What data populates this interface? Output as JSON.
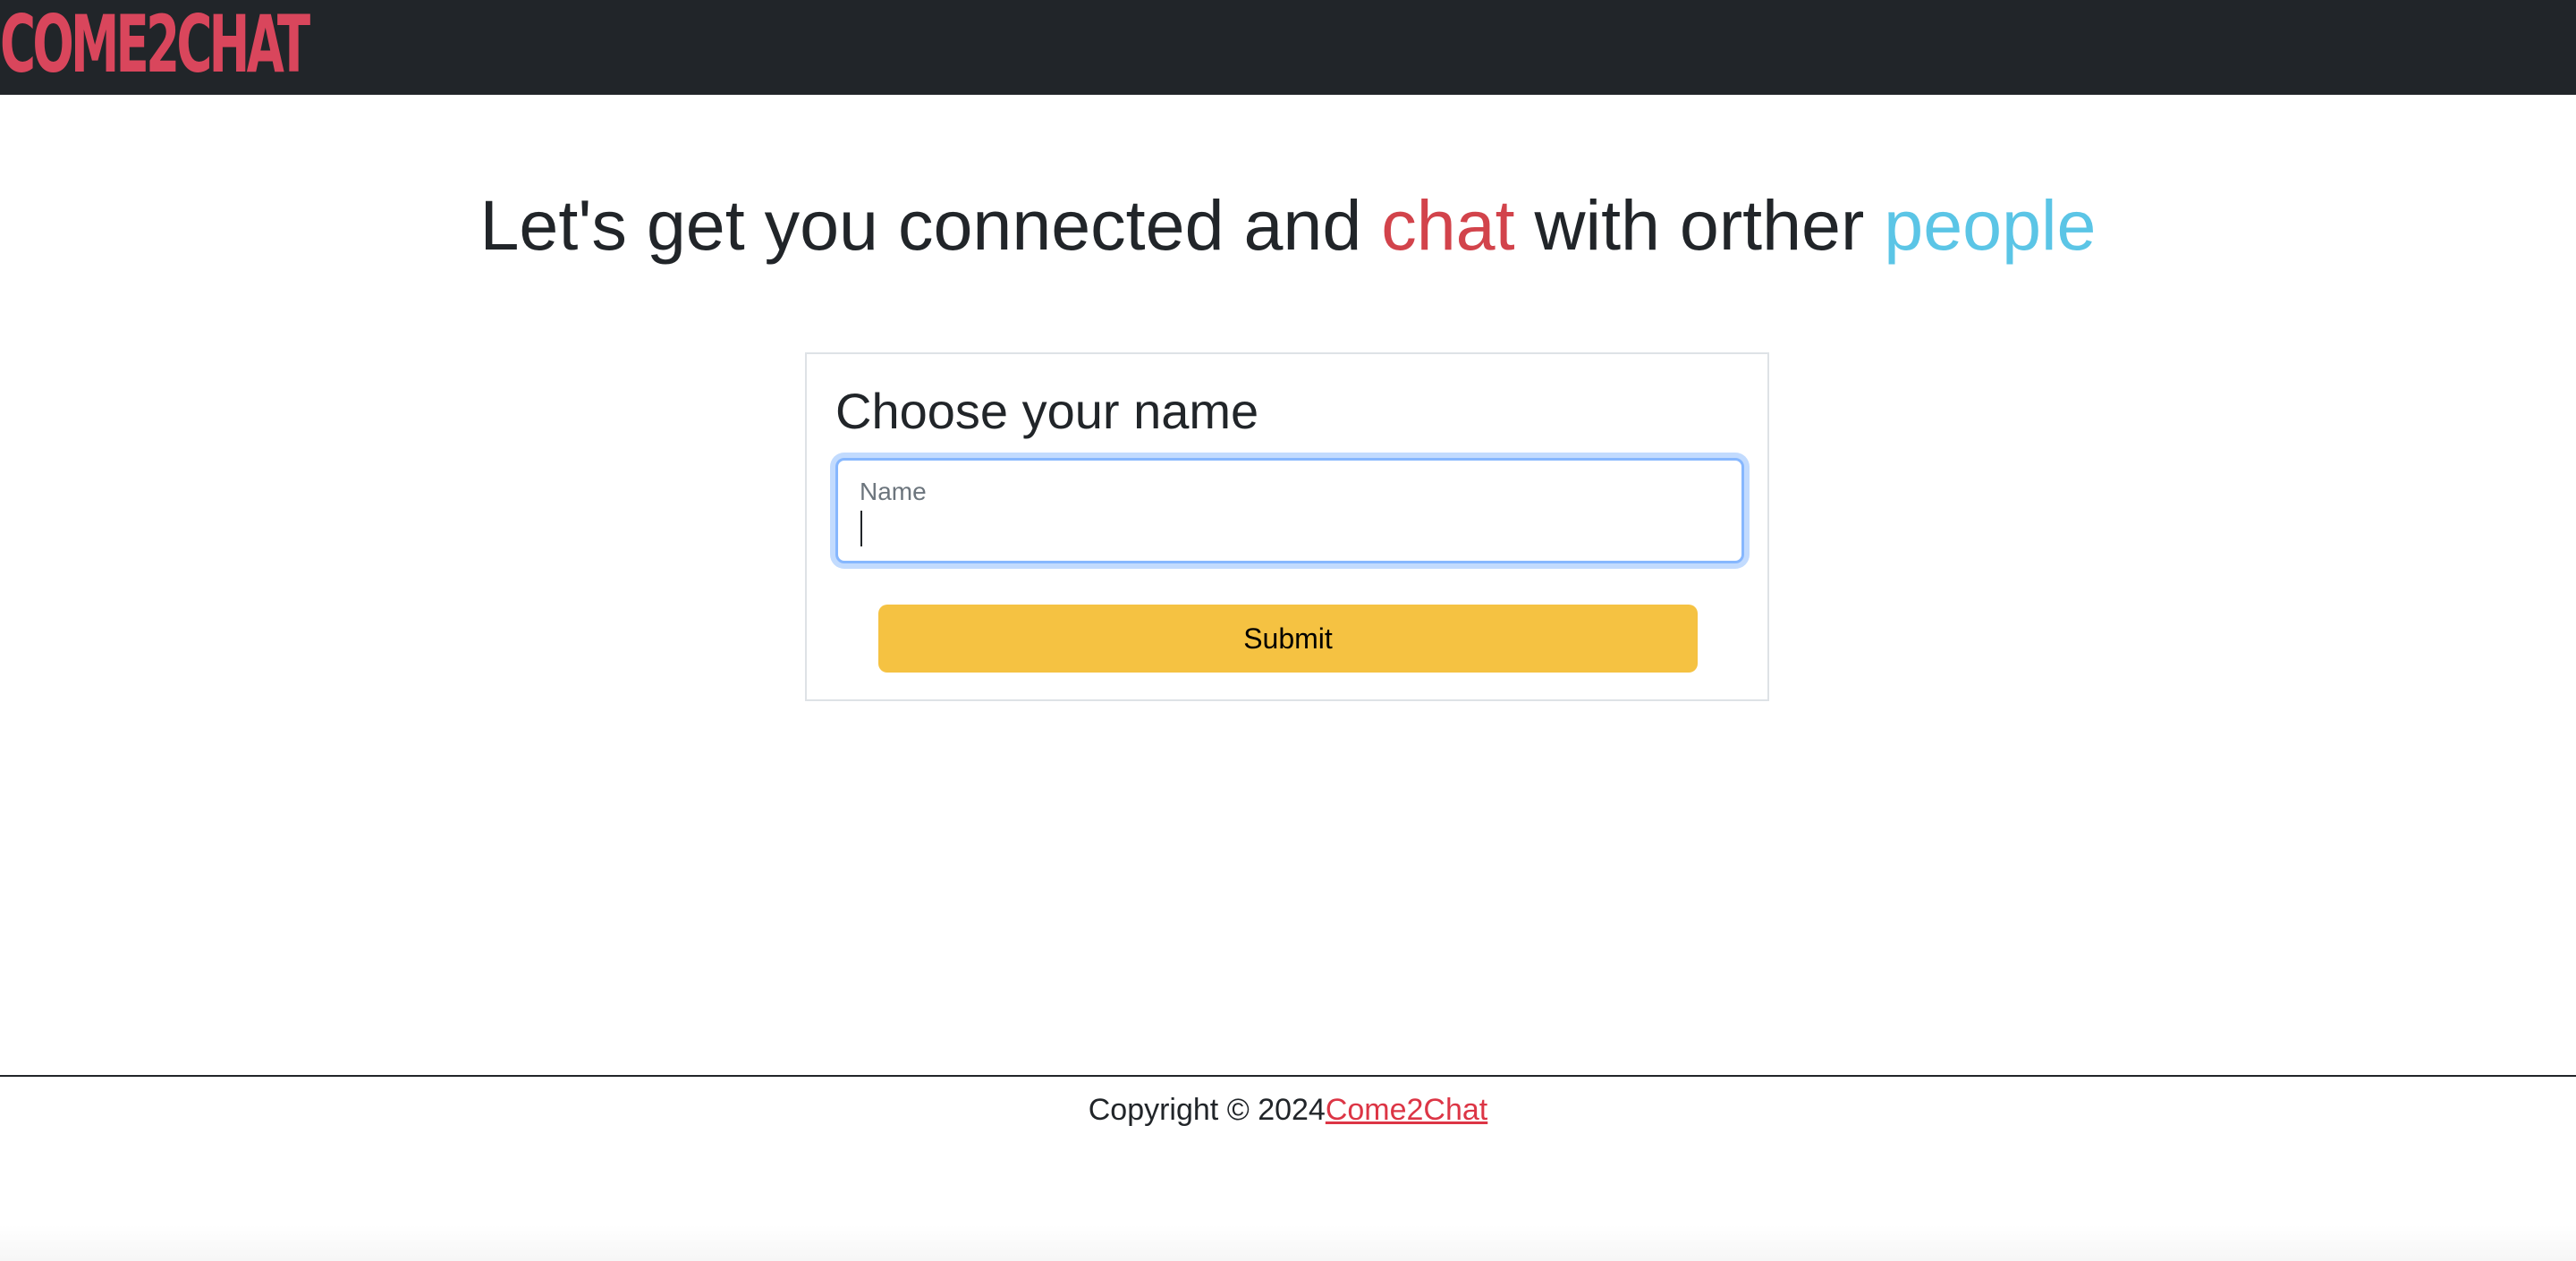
{
  "navbar": {
    "logo_text": "Come2Chat"
  },
  "headline": {
    "part1": "Let's get you connected and ",
    "highlight1": "chat",
    "part2": " with orther ",
    "highlight2": "people"
  },
  "form": {
    "title": "Choose your name",
    "name_label": "Name",
    "name_value": "",
    "submit_label": "Submit"
  },
  "footer": {
    "copyright_text": "Copyright © 2024",
    "brand_link": "Come2Chat"
  },
  "colors": {
    "navbar_bg": "#212529",
    "logo": "#d9465c",
    "highlight_red": "#d2434b",
    "highlight_blue": "#5bc5e6",
    "submit_bg": "#f5c242",
    "focus_ring": "#86b7fe",
    "footer_link": "#dc3545"
  }
}
